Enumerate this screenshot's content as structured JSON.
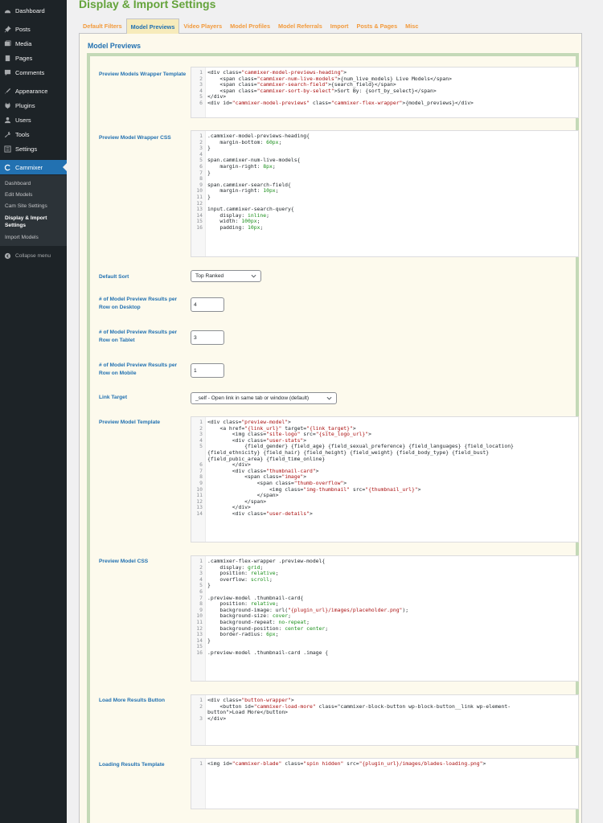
{
  "sidebar": {
    "items": [
      {
        "label": "Dashboard",
        "icon": "dashboard-icon"
      },
      {
        "label": "Posts",
        "icon": "pin-icon"
      },
      {
        "label": "Media",
        "icon": "media-icon"
      },
      {
        "label": "Pages",
        "icon": "pages-icon"
      },
      {
        "label": "Comments",
        "icon": "comments-icon"
      },
      {
        "label": "Appearance",
        "icon": "brush-icon"
      },
      {
        "label": "Plugins",
        "icon": "plugin-icon"
      },
      {
        "label": "Users",
        "icon": "users-icon"
      },
      {
        "label": "Tools",
        "icon": "wrench-icon"
      },
      {
        "label": "Settings",
        "icon": "settings-icon"
      }
    ],
    "active_menu": {
      "label": "Cammixer",
      "icon": "cammixer-icon"
    },
    "submenu": [
      "Dashboard",
      "Edit Models",
      "Cam Site Settings",
      "Display & Import Settings",
      "Import Models"
    ],
    "collapse_label": "Collapse menu"
  },
  "page": {
    "title": "Display & Import Settings",
    "tabs": [
      "Default Filters",
      "Model Previews",
      "Video Players",
      "Model Profiles",
      "Model Referrals",
      "Import",
      "Posts & Pages",
      "Misc"
    ],
    "section_title": "Model Previews"
  },
  "colors": {
    "accent": "#2271b1",
    "title_green": "#64a33b",
    "tab_orange": "#f29a3c",
    "frame_green": "#c4d9b7",
    "panel_bg": "#fdf9ec",
    "sidebar_bg": "#1d2327"
  },
  "fields": {
    "wrapper_template": {
      "label": "Preview Models Wrapper Template",
      "lines": [
        "<div class=\"cammixer-model-previews-heading\">",
        "    <span class=\"cammixer-num-live-models\">{num_live_models} Live Models</span>",
        "    <span class=\"cammixer-search-field\">{search_field}</span>",
        "    <span class=\"cammixer-sort-by-select\">Sort By: {sort_by_select}</span>",
        "</div>",
        "<div id=\"cammixer-model-previews\" class=\"cammixer-flex-wrapper\">{model_previews}</div>"
      ]
    },
    "wrapper_css": {
      "label": "Preview Model Wrapper CSS",
      "lines": [
        ".cammixer-model-previews-heading{",
        "    margin-bottom: 60px;",
        "}",
        "",
        "span.cammixer-num-live-models{",
        "    margin-right: 8px;",
        "}",
        "",
        "span.cammixer-search-field{",
        "    margin-right: 10px;",
        "}",
        "",
        "input.cammixer-search-query{",
        "    display: inline;",
        "    width: 100px;",
        "    padding: 10px;"
      ]
    },
    "default_sort": {
      "label": "Default Sort",
      "value": "Top Ranked"
    },
    "per_row_desktop": {
      "label": "# of Model Preview Results per Row on Desktop",
      "value": "4"
    },
    "per_row_tablet": {
      "label": "# of Model Preview Results per Row on Tablet",
      "value": "3"
    },
    "per_row_mobile": {
      "label": "# of Model Preview Results per Row on Mobile",
      "value": "1"
    },
    "link_target": {
      "label": "Link Target",
      "value": "_self - Open link in same tab or window (default)"
    },
    "preview_template": {
      "label": "Preview Model Template",
      "lines": [
        {
          "n": "1",
          "t": "<div class=\"preview-model\">"
        },
        {
          "n": "2",
          "t": "    <a href=\"{link_url}\" target=\"{link_target}\">"
        },
        {
          "n": "3",
          "t": "        <img class=\"site-logo\" src=\"{site_logo_url}\">"
        },
        {
          "n": "4",
          "t": "        <div class=\"user-stats\">"
        },
        {
          "n": "5",
          "t": "            {field_gender} {field_age} {field_sexual_preference} {field_languages} {field_location}"
        },
        {
          "n": "",
          "t": "{field_ethnicity} {field_hair} {field_height} {field_weight} {field_body_type} {field_bust}"
        },
        {
          "n": "",
          "t": "{field_pubic_area} {field_time_online}"
        },
        {
          "n": "6",
          "t": "        </div>"
        },
        {
          "n": "7",
          "t": "        <div class=\"thumbnail-card\">"
        },
        {
          "n": "8",
          "t": "            <span class=\"image\">"
        },
        {
          "n": "9",
          "t": "                <span class=\"thumb-overflow\">"
        },
        {
          "n": "10",
          "t": "                    <img class=\"img-thumbnail\" src=\"{thumbnail_url}\">"
        },
        {
          "n": "11",
          "t": "                </span>"
        },
        {
          "n": "12",
          "t": "            </span>"
        },
        {
          "n": "13",
          "t": "        </div>"
        },
        {
          "n": "14",
          "t": "        <div class=\"user-details\">"
        }
      ]
    },
    "preview_css": {
      "label": "Preview Model CSS",
      "lines": [
        ".cammixer-flex-wrapper .preview-model{",
        "    display: grid;",
        "    position: relative;",
        "    overflow: scroll;",
        "}",
        "",
        ".preview-model .thumbnail-card{",
        "    position: relative;",
        "    background-image: url(\"{plugin_url}/images/placeholder.png\");",
        "    background-size: cover;",
        "    background-repeat: no-repeat;",
        "    background-position: center center;",
        "    border-radius: 6px;",
        "}",
        "",
        ".preview-model .thumbnail-card .image {"
      ]
    },
    "load_more": {
      "label": "Load More Results Button",
      "lines": [
        {
          "n": "1",
          "t": "<div class=\"button-wrapper\">"
        },
        {
          "n": "2",
          "t": "    <button id=\"cammixer-load-more\" class=\"cammixer-block-button wp-block-button__link wp-element-"
        },
        {
          "n": "",
          "t": "button\">Load More</button>"
        },
        {
          "n": "3",
          "t": "</div>"
        }
      ]
    },
    "loading_template": {
      "label": "Loading Results Template",
      "lines": [
        "<img id=\"cammixer-blade\" class=\"spin hidden\" src=\"{plugin_url}/images/blades-loading.png\">"
      ]
    }
  }
}
